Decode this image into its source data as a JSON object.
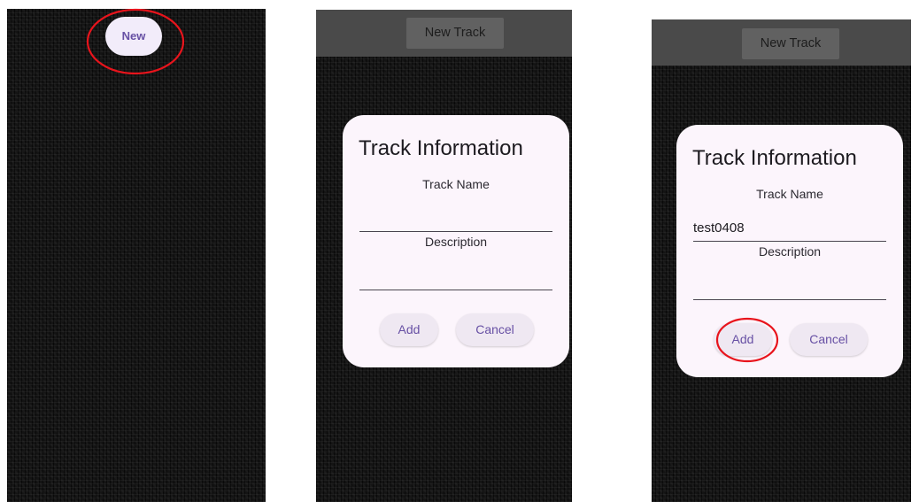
{
  "screens": [
    {
      "new_button_label": "New"
    },
    {
      "appbar_button_label": "New Track",
      "dialog": {
        "title": "Track Information",
        "track_name_label": "Track Name",
        "track_name_value": "",
        "description_label": "Description",
        "description_value": "",
        "add_label": "Add",
        "cancel_label": "Cancel"
      }
    },
    {
      "appbar_button_label": "New Track",
      "dialog": {
        "title": "Track Information",
        "track_name_label": "Track Name",
        "track_name_value": "test0408",
        "description_label": "Description",
        "description_value": "",
        "add_label": "Add",
        "cancel_label": "Cancel"
      }
    }
  ],
  "annotations": {
    "highlight_color": "#e8141c",
    "targets": [
      "new-button",
      "add-button"
    ]
  },
  "colors": {
    "background": "#141414",
    "appbar": "#4a4a4a",
    "appbar_button": "#616161",
    "dialog": "#fcf5fc",
    "accent": "#6750a4"
  }
}
